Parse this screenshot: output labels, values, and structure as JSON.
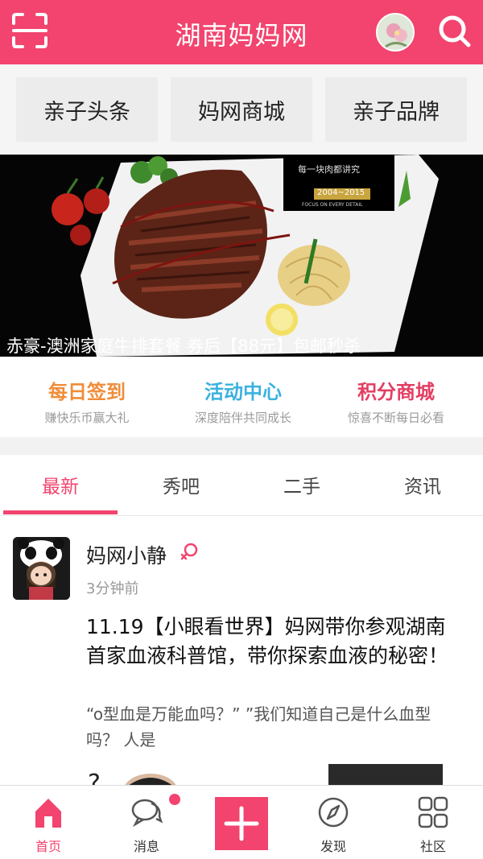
{
  "header": {
    "title": "湖南妈妈网",
    "scan_icon": "scan-icon",
    "search_icon": "search-icon",
    "avatar_icon": "avatar"
  },
  "categories": [
    "亲子头条",
    "妈网商城",
    "亲子品牌"
  ],
  "banner": {
    "caption": "赤豪-澳洲家庭牛排套餐 券后【88元】包邮秒杀",
    "label_top": "每一块肉都讲究",
    "label_years": "2004~2015",
    "label_sub": "FOCUS ON EVERY DETAIL",
    "active_dot": 1,
    "dot_count": 6
  },
  "features": [
    {
      "title": "每日签到",
      "subtitle": "赚快乐币赢大礼",
      "color": "#f08d39"
    },
    {
      "title": "活动中心",
      "subtitle": "深度陪伴共同成长",
      "color": "#3bb1df"
    },
    {
      "title": "积分商城",
      "subtitle": "惊喜不断每日必看",
      "color": "#e33f63"
    }
  ],
  "tabs": [
    "最新",
    "秀吧",
    "二手",
    "资讯"
  ],
  "post": {
    "author": "妈网小静",
    "time": "3分钟前",
    "title": "11.19【小眼看世界】妈网带你参观湖南首家血液科普馆，带你探索血液的秘密！",
    "excerpt": "“o型血是万能血吗？” ”我们知道自己是什么血型吗？       人是"
  },
  "bottom_nav": [
    {
      "label": "首页",
      "icon": "home-icon"
    },
    {
      "label": "消息",
      "icon": "message-icon"
    },
    {
      "label": "",
      "icon": "plus-icon"
    },
    {
      "label": "发现",
      "icon": "compass-icon"
    },
    {
      "label": "社区",
      "icon": "grid-icon"
    }
  ],
  "colors": {
    "brand": "#f2446e"
  }
}
